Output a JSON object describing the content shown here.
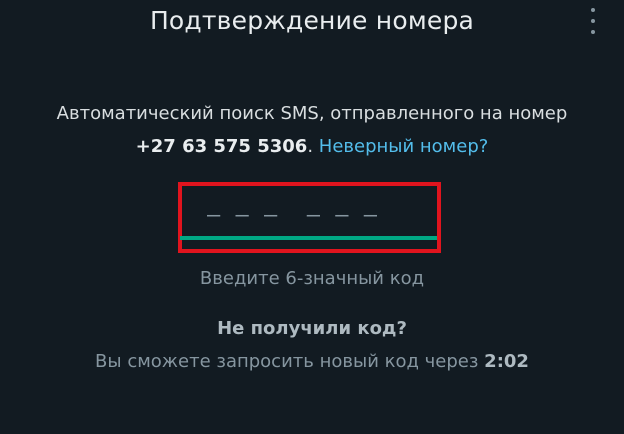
{
  "header": {
    "title": "Подтверждение номера",
    "menu_icon": "more-vertical-icon"
  },
  "description": {
    "text": "Автоматический поиск SMS, отправленного на номер",
    "phone": "+27 63 575 5306",
    "separator": ". ",
    "wrong_number_link": "Неверный номер?"
  },
  "code_input": {
    "placeholder": "— — —  — — —",
    "digits_entered": "",
    "accent_color": "#00a884",
    "highlight_color": "#e0141e"
  },
  "hint": "Введите 6-значный код",
  "resend": {
    "title": "Не получили код?",
    "text": "Вы сможете запросить новый код через ",
    "timer": "2:02"
  }
}
